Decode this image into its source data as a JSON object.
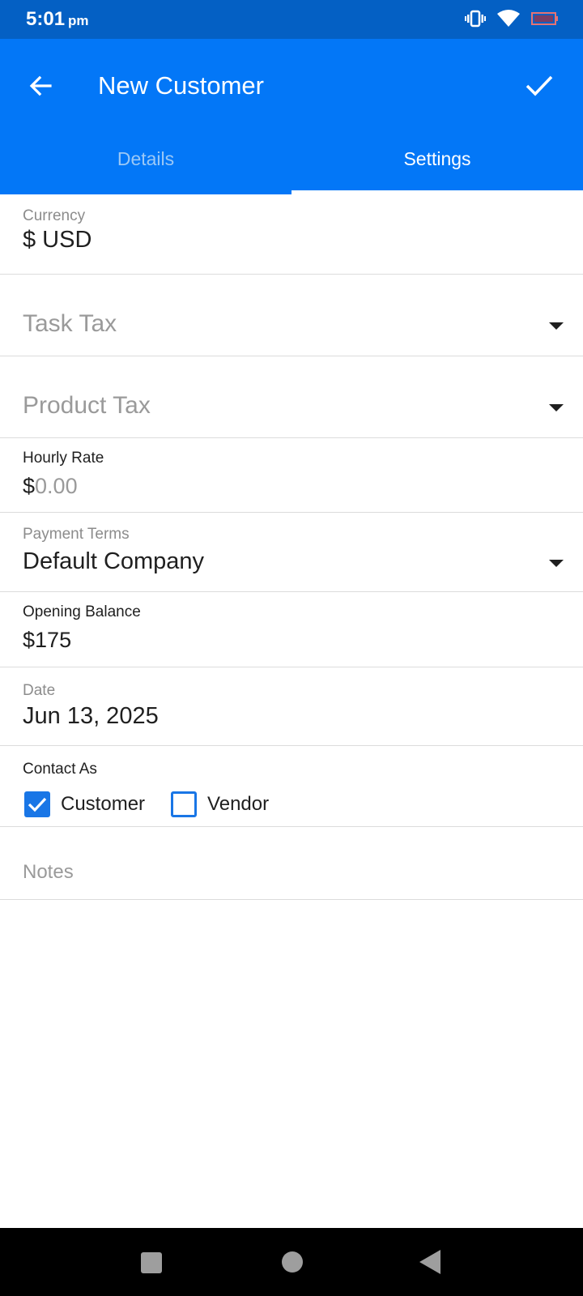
{
  "status": {
    "time": "5:01",
    "ampm": "pm",
    "icons": [
      "vibrate-icon",
      "wifi-icon",
      "battery-low-icon"
    ]
  },
  "header": {
    "title": "New Customer",
    "back_icon": "arrow-left-icon",
    "save_icon": "check-icon"
  },
  "tabs": [
    {
      "label": "Details",
      "active": false
    },
    {
      "label": "Settings",
      "active": true
    }
  ],
  "form": {
    "currency": {
      "label": "Currency",
      "value": "$ USD"
    },
    "task_tax": {
      "placeholder": "Task Tax"
    },
    "product_tax": {
      "placeholder": "Product Tax"
    },
    "hourly_rate": {
      "label": "Hourly Rate",
      "prefix": "$",
      "placeholder": "0.00"
    },
    "payment_terms": {
      "label": "Payment Terms",
      "value": "Default Company"
    },
    "opening_balance": {
      "label": "Opening Balance",
      "prefix": "$",
      "value": "175"
    },
    "date": {
      "label": "Date",
      "value": "Jun 13, 2025"
    },
    "contact_as": {
      "label": "Contact As",
      "options": [
        {
          "label": "Customer",
          "checked": true
        },
        {
          "label": "Vendor",
          "checked": false
        }
      ]
    },
    "notes": {
      "placeholder": "Notes"
    }
  },
  "colors": {
    "status_bar": "#0460c4",
    "app_bar": "#0377f7",
    "accent": "#1976e6"
  },
  "nav": {
    "icons": [
      "recents-square-icon",
      "home-circle-icon",
      "back-triangle-icon"
    ]
  }
}
